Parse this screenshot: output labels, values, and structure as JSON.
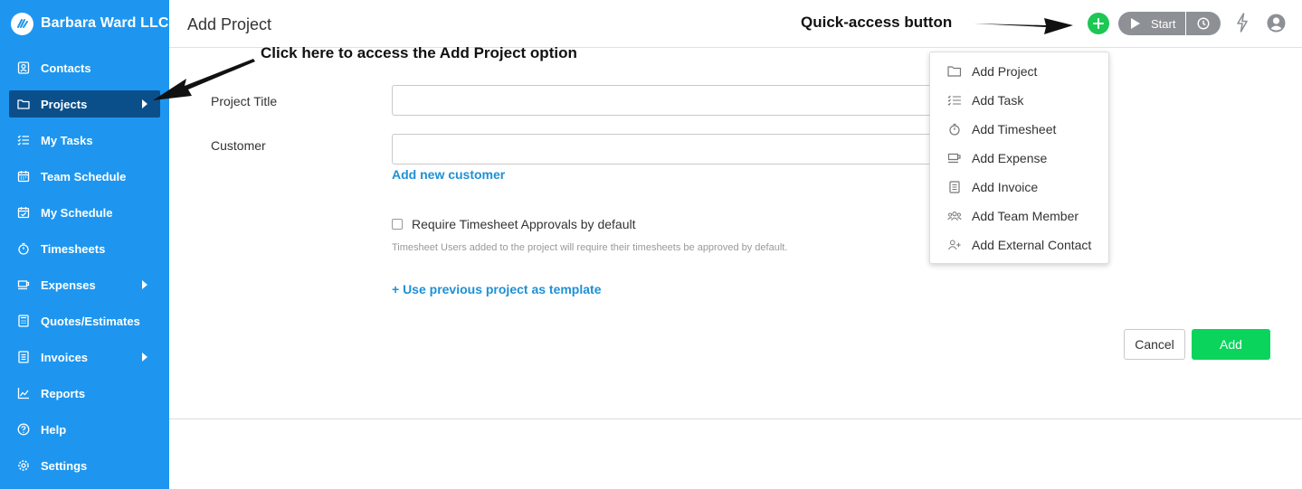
{
  "brand": {
    "name": "Barbara Ward LLC"
  },
  "sidebar": {
    "items": [
      {
        "label": "Contacts",
        "icon": "contacts-icon"
      },
      {
        "label": "Projects",
        "icon": "folder-icon",
        "active": true,
        "has_submenu": true
      },
      {
        "label": "My Tasks",
        "icon": "tasks-icon"
      },
      {
        "label": "Team Schedule",
        "icon": "calendar-icon"
      },
      {
        "label": "My Schedule",
        "icon": "calendar-check-icon"
      },
      {
        "label": "Timesheets",
        "icon": "stopwatch-icon"
      },
      {
        "label": "Expenses",
        "icon": "cup-icon",
        "has_submenu": true
      },
      {
        "label": "Quotes/Estimates",
        "icon": "calculator-icon"
      },
      {
        "label": "Invoices",
        "icon": "invoice-icon",
        "has_submenu": true
      },
      {
        "label": "Reports",
        "icon": "chart-icon"
      },
      {
        "label": "Help",
        "icon": "help-icon"
      },
      {
        "label": "Settings",
        "icon": "gear-icon"
      }
    ]
  },
  "header": {
    "title": "Add Project",
    "start_label": "Start"
  },
  "annotations": {
    "quick_access": "Quick-access button",
    "projects_hint": "Click here to access the Add Project option"
  },
  "form": {
    "project_title_label": "Project Title",
    "project_title_value": "",
    "customer_label": "Customer",
    "customer_value": "",
    "add_customer_link": "Add new customer",
    "approval_label": "Require Timesheet Approvals by default",
    "approval_help": "Timesheet Users added to the project will require their timesheets be approved by default.",
    "template_link": "+ Use previous project as template",
    "cancel_label": "Cancel",
    "add_label": "Add"
  },
  "quick_menu": {
    "items": [
      {
        "label": "Add Project",
        "icon": "folder-icon"
      },
      {
        "label": "Add Task",
        "icon": "tasks-icon"
      },
      {
        "label": "Add Timesheet",
        "icon": "stopwatch-icon"
      },
      {
        "label": "Add Expense",
        "icon": "cup-icon"
      },
      {
        "label": "Add Invoice",
        "icon": "invoice-icon"
      },
      {
        "label": "Add Team Member",
        "icon": "team-icon"
      },
      {
        "label": "Add External Contact",
        "icon": "add-user-icon"
      }
    ]
  },
  "colors": {
    "sidebar": "#1e96ef",
    "sidebar_active": "#0b4f8a",
    "accent_green": "#0ad45c",
    "link_blue": "#1e90d6"
  }
}
